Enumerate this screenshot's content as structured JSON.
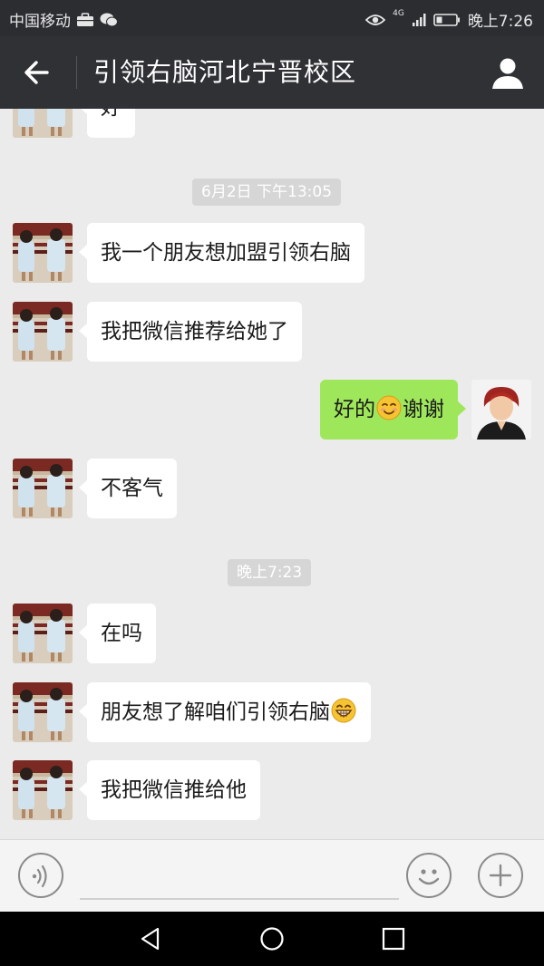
{
  "status_bar": {
    "carrier": "中国移动",
    "time": "晚上7:26",
    "network": "4G"
  },
  "header": {
    "title": "引领右脑河北宁晋校区"
  },
  "messages": [
    {
      "side": "left",
      "text": "好"
    },
    {
      "timestamp": "6月2日 下午13:05"
    },
    {
      "side": "left",
      "text": "我一个朋友想加盟引领右脑"
    },
    {
      "side": "left",
      "text": "我把微信推荐给她了"
    },
    {
      "side": "right",
      "text_before": "好的",
      "emoji": "smiling-emoji",
      "text_after": "谢谢"
    },
    {
      "side": "left",
      "text": "不客气"
    },
    {
      "timestamp": "晚上7:23"
    },
    {
      "side": "left",
      "text": "在吗"
    },
    {
      "side": "left",
      "text": "朋友想了解咱们引领右脑",
      "emoji": "grinning-emoji"
    },
    {
      "side": "left",
      "text": "我把微信推给他"
    }
  ],
  "colors": {
    "title_bar": "#2f3135",
    "chat_background": "#ebebeb",
    "sent_bubble": "#9fe75a",
    "received_bubble": "#ffffff"
  }
}
